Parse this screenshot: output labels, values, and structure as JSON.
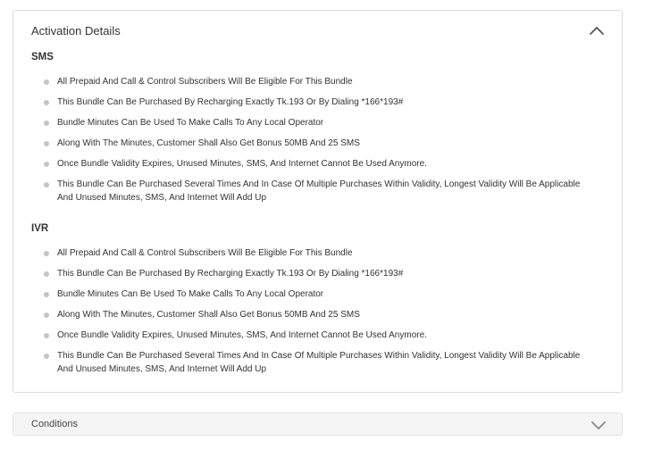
{
  "activation": {
    "title": "Activation Details",
    "sections": [
      {
        "title": "SMS",
        "items": [
          "All Prepaid And Call & Control Subscribers Will Be Eligible For This Bundle",
          "This Bundle Can Be Purchased By Recharging Exactly Tk.193 Or By Dialing *166*193#",
          "Bundle Minutes Can Be Used To Make Calls To Any Local Operator",
          "Along With The Minutes, Customer Shall Also Get Bonus 50MB And 25 SMS",
          "Once Bundle Validity Expires, Unused Minutes, SMS, And Internet Cannot Be Used Anymore.",
          "This Bundle Can Be Purchased Several Times And In Case Of Multiple Purchases Within Validity, Longest Validity Will Be Applicable And Unused Minutes, SMS, And Internet Will Add Up"
        ]
      },
      {
        "title": "IVR",
        "items": [
          "All Prepaid And Call & Control Subscribers Will Be Eligible For This Bundle",
          "This Bundle Can Be Purchased By Recharging Exactly Tk.193 Or By Dialing *166*193#",
          "Bundle Minutes Can Be Used To Make Calls To Any Local Operator",
          "Along With The Minutes, Customer Shall Also Get Bonus 50MB And 25 SMS",
          "Once Bundle Validity Expires, Unused Minutes, SMS, And Internet Cannot Be Used Anymore.",
          "This Bundle Can Be Purchased Several Times And In Case Of Multiple Purchases Within Validity, Longest Validity Will Be Applicable And Unused Minutes, SMS, And Internet Will Add Up"
        ]
      }
    ],
    "collapse_icon": "chevron-up-icon"
  },
  "conditions": {
    "title": "Conditions",
    "expand_icon": "chevron-down-icon"
  }
}
